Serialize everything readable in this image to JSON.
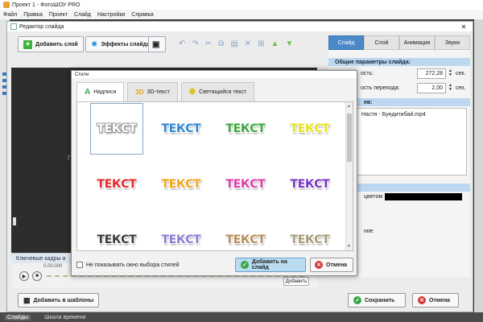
{
  "app": {
    "title": "Проект 1 - ФотоШОУ PRO",
    "menu": [
      "Файл",
      "Правка",
      "Проект",
      "Слайд",
      "Настройки",
      "Справка"
    ],
    "bottom_tabs": [
      "Слайды",
      "Шкала времени"
    ]
  },
  "editor": {
    "title": "Редактор слайда",
    "add_layer": "Добавить слой",
    "slide_effects": "Эффекты слайда",
    "preview_faint": "ПО",
    "keyframes_label": "Ключевые кадры а",
    "keyframes_time": "0.00.000",
    "add_label": "Добавить",
    "add_to_templates": "Добавить в шаблоны",
    "save": "Сохранить",
    "cancel": "Отмена"
  },
  "right_panel": {
    "tabs": [
      "Слайд",
      "Слой",
      "Анимация",
      "Звуки"
    ],
    "active_tab": "Слайд",
    "general_header": "Общие параметры слайда:",
    "duration_label": "ость:",
    "duration_value": "272,28",
    "transition_label": "ость перехода:",
    "transition_value": "2,00",
    "unit": "сек.",
    "layers_header": "ев:",
    "layer_item": "Настя - Бундитибай.mp4",
    "color_label": "цветом",
    "lower_label": "ние"
  },
  "styles_dialog": {
    "title": "Стили",
    "tabs": [
      {
        "label": "Надписи",
        "icon": "letter-a-icon"
      },
      {
        "label": "3D-текст",
        "icon": "3d-icon"
      },
      {
        "label": "Светящийся текст",
        "icon": "glow-icon"
      }
    ],
    "active_tab": "Надписи",
    "sample_text": "ТЕКСТ",
    "samples": [
      {
        "fill": "#ffffff",
        "stroke": "#9a9a9a"
      },
      {
        "fill": "#2b86d6",
        "stroke": "#ffffff"
      },
      {
        "fill": "#3aa83a",
        "stroke": "#ffffff"
      },
      {
        "fill": "#e6e21a",
        "stroke": "#ffffff"
      },
      {
        "fill": "#e0282a",
        "stroke": "#ffffff"
      },
      {
        "fill": "#f2a41a",
        "stroke": "#ffffff"
      },
      {
        "fill": "#e03aa8",
        "stroke": "#ffffff"
      },
      {
        "fill": "#7a34c8",
        "stroke": "#ffffff"
      },
      {
        "fill": "#3a3a3a",
        "stroke": "#ffffff"
      },
      {
        "fill": "#8a7ad8",
        "stroke": "#ffffff"
      },
      {
        "fill": "#b88c5a",
        "stroke": "#ffffff"
      },
      {
        "fill": "#a89a7a",
        "stroke": "#ffffff"
      }
    ],
    "dont_show": "Не показывать окно выбора стилей",
    "add_to_slide": "Добавить на слайд",
    "cancel": "Отмена"
  }
}
